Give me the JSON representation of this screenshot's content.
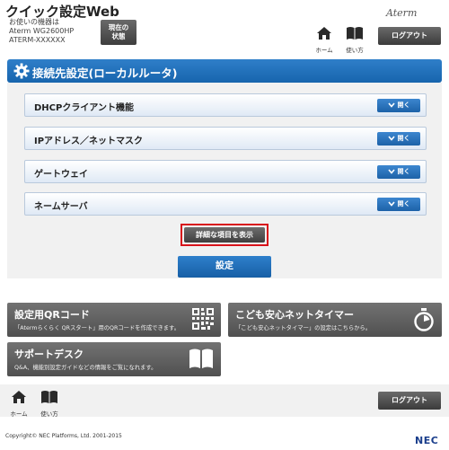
{
  "header": {
    "app_title": "クイック設定Web",
    "device_lines": [
      "お使いの機器は",
      "Aterm WG2600HP",
      "ATERM-XXXXXX"
    ],
    "status_button": [
      "現在の",
      "状態"
    ],
    "brand": "Aterm",
    "home_label": "ホーム",
    "manual_label": "使い方",
    "logout_label": "ログアウト"
  },
  "section": {
    "title": "接続先設定(ローカルルータ)"
  },
  "accordions": [
    {
      "label": "DHCPクライアント機能",
      "button": "開く"
    },
    {
      "label": "IPアドレス／ネットマスク",
      "button": "開く"
    },
    {
      "label": "ゲートウェイ",
      "button": "開く"
    },
    {
      "label": "ネームサーバ",
      "button": "開く"
    }
  ],
  "actions": {
    "detail_label": "詳細な項目を表示",
    "apply_label": "設定"
  },
  "tiles": [
    {
      "title": "設定用QRコード",
      "desc": "「Atermらくらく QRスタート」用のQRコードを作成できます。",
      "icon": "qr-code-icon"
    },
    {
      "title": "こども安心ネットタイマー",
      "desc": "「こども安心ネットタイマー」の設定はこちらから。",
      "icon": "stopwatch-icon"
    },
    {
      "title": "サポートデスク",
      "desc": "Q&A、機能別設定ガイドなどの情報をご覧になれます。",
      "icon": "book-icon"
    }
  ],
  "footer": {
    "home_label": "ホーム",
    "manual_label": "使い方",
    "logout_label": "ログアウト",
    "copyright": "Copyright© NEC Platforms, Ltd. 2001-2015",
    "vendor": "NEC"
  },
  "colors": {
    "accent_blue": "#1f6fbd",
    "button_gray": "#505050",
    "highlight_red": "#d8121a"
  }
}
